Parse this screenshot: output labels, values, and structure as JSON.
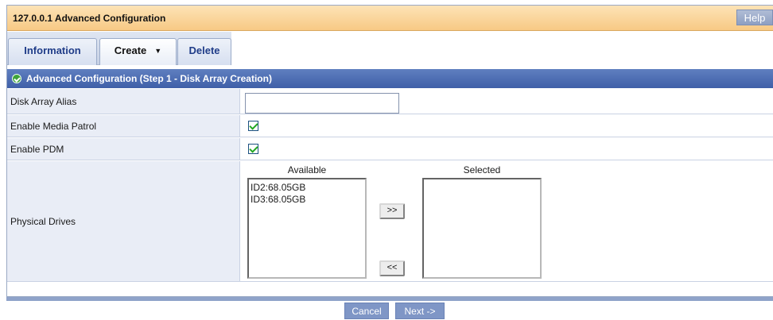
{
  "window": {
    "title": "127.0.0.1 Advanced Configuration",
    "help_label": "Help"
  },
  "tabs": [
    {
      "label": "Information"
    },
    {
      "label": "Create",
      "dropdown_glyph": "▼"
    },
    {
      "label": "Delete"
    }
  ],
  "section": {
    "title": "Advanced Configuration (Step 1 - Disk Array Creation)",
    "icon": "check-circle-icon"
  },
  "form": {
    "alias_label": "Disk Array Alias",
    "alias_value": "",
    "media_patrol_label": "Enable Media Patrol",
    "media_patrol_checked": true,
    "pdm_label": "Enable PDM",
    "pdm_checked": true,
    "drives_label": "Physical Drives",
    "available_caption": "Available",
    "selected_caption": "Selected",
    "available": [
      "ID2:68.05GB",
      "ID3:68.05GB"
    ],
    "selected": [],
    "add_label": ">>",
    "remove_label": "<<"
  },
  "footer": {
    "cancel_label": "Cancel",
    "next_label": "Next ->"
  },
  "colors": {
    "title_bg": "#f7c985",
    "section_bg": "#4a69b0",
    "label_bg": "#e9edf6",
    "button_bg": "#7f96c6"
  }
}
